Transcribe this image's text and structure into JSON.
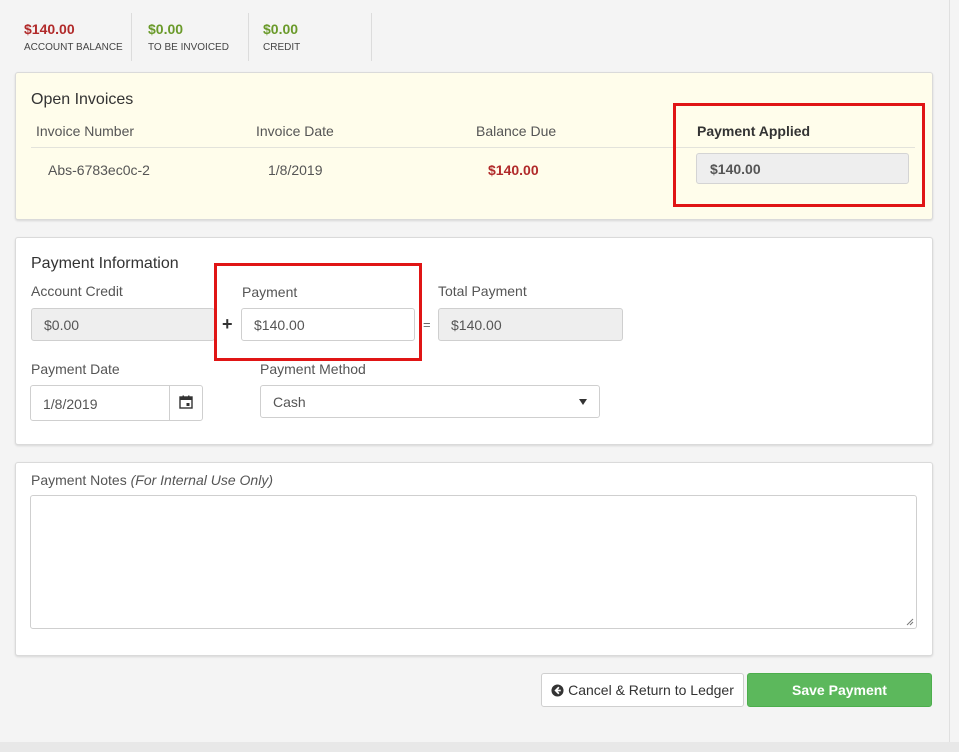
{
  "summary": {
    "account_balance": {
      "value": "$140.00",
      "label": "ACCOUNT BALANCE",
      "color": "#b12a2a"
    },
    "to_be_invoiced": {
      "value": "$0.00",
      "label": "TO BE INVOICED",
      "color": "#6a9a2a"
    },
    "credit": {
      "value": "$0.00",
      "label": "CREDIT",
      "color": "#6a9a2a"
    }
  },
  "open_invoices": {
    "title": "Open Invoices",
    "columns": {
      "number": "Invoice Number",
      "date": "Invoice Date",
      "balance": "Balance Due",
      "applied": "Payment Applied"
    },
    "rows": [
      {
        "number": "Abs-6783ec0c-2",
        "date": "1/8/2019",
        "balance": "$140.00",
        "applied": "$140.00"
      }
    ]
  },
  "payment_info": {
    "title": "Payment Information",
    "account_credit_label": "Account Credit",
    "account_credit_value": "$0.00",
    "payment_label": "Payment",
    "payment_value": "$140.00",
    "plus_symbol": "+",
    "equals_symbol": "=",
    "total_label": "Total Payment",
    "total_value": "$140.00",
    "date_label": "Payment Date",
    "date_value": "1/8/2019",
    "calendar_icon": "calendar-icon",
    "method_label": "Payment Method",
    "method_value": "Cash"
  },
  "notes": {
    "label": "Payment Notes",
    "label_hint": "(For Internal Use Only)",
    "value": ""
  },
  "actions": {
    "cancel_label": "Cancel & Return to Ledger",
    "cancel_icon": "circle-arrow-left-icon",
    "save_label": "Save Payment"
  },
  "colors": {
    "highlight_frame": "#e01515",
    "save_button": "#5cb85c",
    "invoice_panel_bg": "#fffdeb"
  }
}
